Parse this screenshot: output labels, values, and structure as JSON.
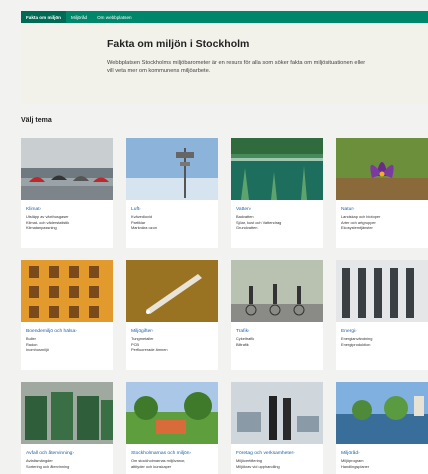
{
  "topnav": {
    "tabs": [
      {
        "label": "Fakta om miljön",
        "active": true
      },
      {
        "label": "Miljöråd",
        "active": false
      },
      {
        "label": "Om webbplatsen",
        "active": false
      }
    ]
  },
  "hero": {
    "title": "Fakta om miljön i Stockholm",
    "intro": "Webbplatsen Stockholms miljöbarometer är en resurs för alla som söker fakta om miljösituationen eller vill veta mer om kommunens miljöarbete."
  },
  "section_title": "Välj tema",
  "colors": {
    "brand_green": "#00866a",
    "link_blue": "#1f5fa8"
  },
  "themes": [
    {
      "title": "Klimat",
      "icon": "umbrella-photo",
      "links": [
        "Utsläpp av växthusgaser",
        "Klimat- och väderstatistik",
        "Klimatanpassning"
      ]
    },
    {
      "title": "Luft",
      "icon": "air-station-photo",
      "links": [
        "Kvävedioxid",
        "Partiklar",
        "Marknära ozon"
      ]
    },
    {
      "title": "Vatten",
      "icon": "lake-photo",
      "links": [
        "Badvatten",
        "Sjöar, kust och Vattendrag",
        "Grundvatten"
      ]
    },
    {
      "title": "Natur",
      "icon": "crocus-photo",
      "links": [
        "Landskap och biotoper",
        "Arter och artgrupper",
        "Ekosystemtjänster"
      ]
    },
    {
      "title": "Boendemiljö och hälsa",
      "icon": "facade-photo",
      "links": [
        "Buller",
        "Radon",
        "Inomhusmiljö"
      ]
    },
    {
      "title": "Miljögifter",
      "icon": "pipette-photo",
      "links": [
        "Tungmetaller",
        "PCB",
        "Perfluorerade ämnen"
      ]
    },
    {
      "title": "Trafik",
      "icon": "cyclists-photo",
      "links": [
        "Cykeltrafik",
        "Biltrafik"
      ]
    },
    {
      "title": "Energi",
      "icon": "building-photo",
      "links": [
        "Energianvändning",
        "Energiproduktion"
      ]
    },
    {
      "title": "Avfall och återvinning",
      "icon": "recycling-photo",
      "links": [
        "Avfallsmängder",
        "Sortering och återvinning"
      ]
    },
    {
      "title": "Stockholmarnas och miljön",
      "icon": "park-photo",
      "links": [
        "Om stockholmarnas miljövanor,",
        "attityder och kunskaper"
      ]
    },
    {
      "title": "Företag och verksamheter",
      "icon": "office-photo",
      "links": [
        "Miljöcertifiering",
        "Miljökrav vid upphandling"
      ]
    },
    {
      "title": "Miljöråd",
      "icon": "waterfront-photo",
      "links": [
        "Miljöprogram",
        "Handlingsplaner"
      ]
    }
  ]
}
